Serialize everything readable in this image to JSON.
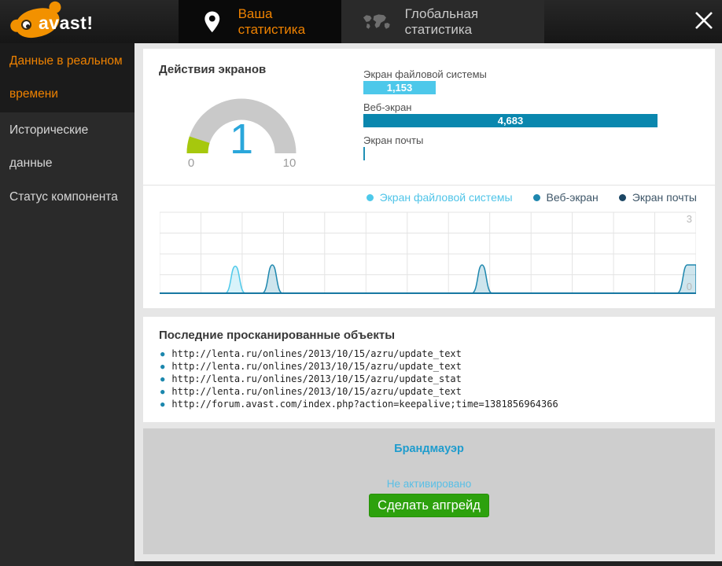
{
  "header": {
    "logo_text": "avast!",
    "tabs": [
      {
        "label": "Ваша статистика",
        "active": true
      },
      {
        "label": "Глобальная статистика",
        "active": false
      }
    ]
  },
  "sidebar": {
    "items": [
      {
        "label": "Данные в реальном времени",
        "active": true
      },
      {
        "label": "Исторические данные",
        "active": false
      },
      {
        "label": "Статус компонента",
        "active": false
      }
    ]
  },
  "screen_actions": {
    "title": "Действия экранов",
    "gauge": {
      "value": 1,
      "min": 0,
      "max": 10,
      "display": "1",
      "min_label": "0",
      "max_label": "10",
      "track_color": "#c9c9c9",
      "fill_color": "#a6c80d",
      "value_color": "#2aa7db"
    },
    "bars": [
      {
        "label": "Экран файловой системы",
        "value_display": "1,153",
        "number": 1153,
        "color": "#4dc8ea"
      },
      {
        "label": "Веб-экран",
        "value_display": "4,683",
        "number": 4683,
        "color": "#0a87ae"
      },
      {
        "label": "Экран почты",
        "value_display": "",
        "number": 0,
        "color": "#2090b5"
      }
    ]
  },
  "chart_data": {
    "type": "area",
    "title": "",
    "xlabel": "",
    "ylabel": "",
    "ylim": [
      0,
      3
    ],
    "y_tick_labels": [
      "3",
      "0"
    ],
    "grid": true,
    "legend_position": "top-right",
    "baseline_color": "#1878a2",
    "grid_color": "#e4e4e4",
    "tick_color": "#b8b8b8",
    "series": [
      {
        "name": "Экран файловой системы",
        "color": "#4ec9ea",
        "text_color": "#4fc4e8",
        "peaks": [
          {
            "x_frac": 0.141,
            "value": 1.0
          }
        ]
      },
      {
        "name": "Веб-экран",
        "color": "#1e87ae",
        "text_color": "#3e5668",
        "peaks": [
          {
            "x_frac": 0.21,
            "value": 1.05
          },
          {
            "x_frac": 0.601,
            "value": 1.05
          },
          {
            "x_frac": 0.985,
            "value": 1.05,
            "clipped": true
          }
        ]
      },
      {
        "name": "Экран почты",
        "color": "#1c4664",
        "text_color": "#3e5668",
        "peaks": []
      }
    ]
  },
  "scanned": {
    "title": "Последние просканированные объекты",
    "items": [
      "http://lenta.ru/onlines/2013/10/15/azru/update_text",
      "http://lenta.ru/onlines/2013/10/15/azru/update_text",
      "http://lenta.ru/onlines/2013/10/15/azru/update_stat",
      "http://lenta.ru/onlines/2013/10/15/azru/update_text",
      "http://forum.avast.com/index.php?action=keepalive;time=1381856964366"
    ]
  },
  "firewall": {
    "title": "Брандмауэр",
    "status": "Не активировано",
    "button_label": "Сделать апгрейд",
    "button_color": "#2da10d"
  }
}
